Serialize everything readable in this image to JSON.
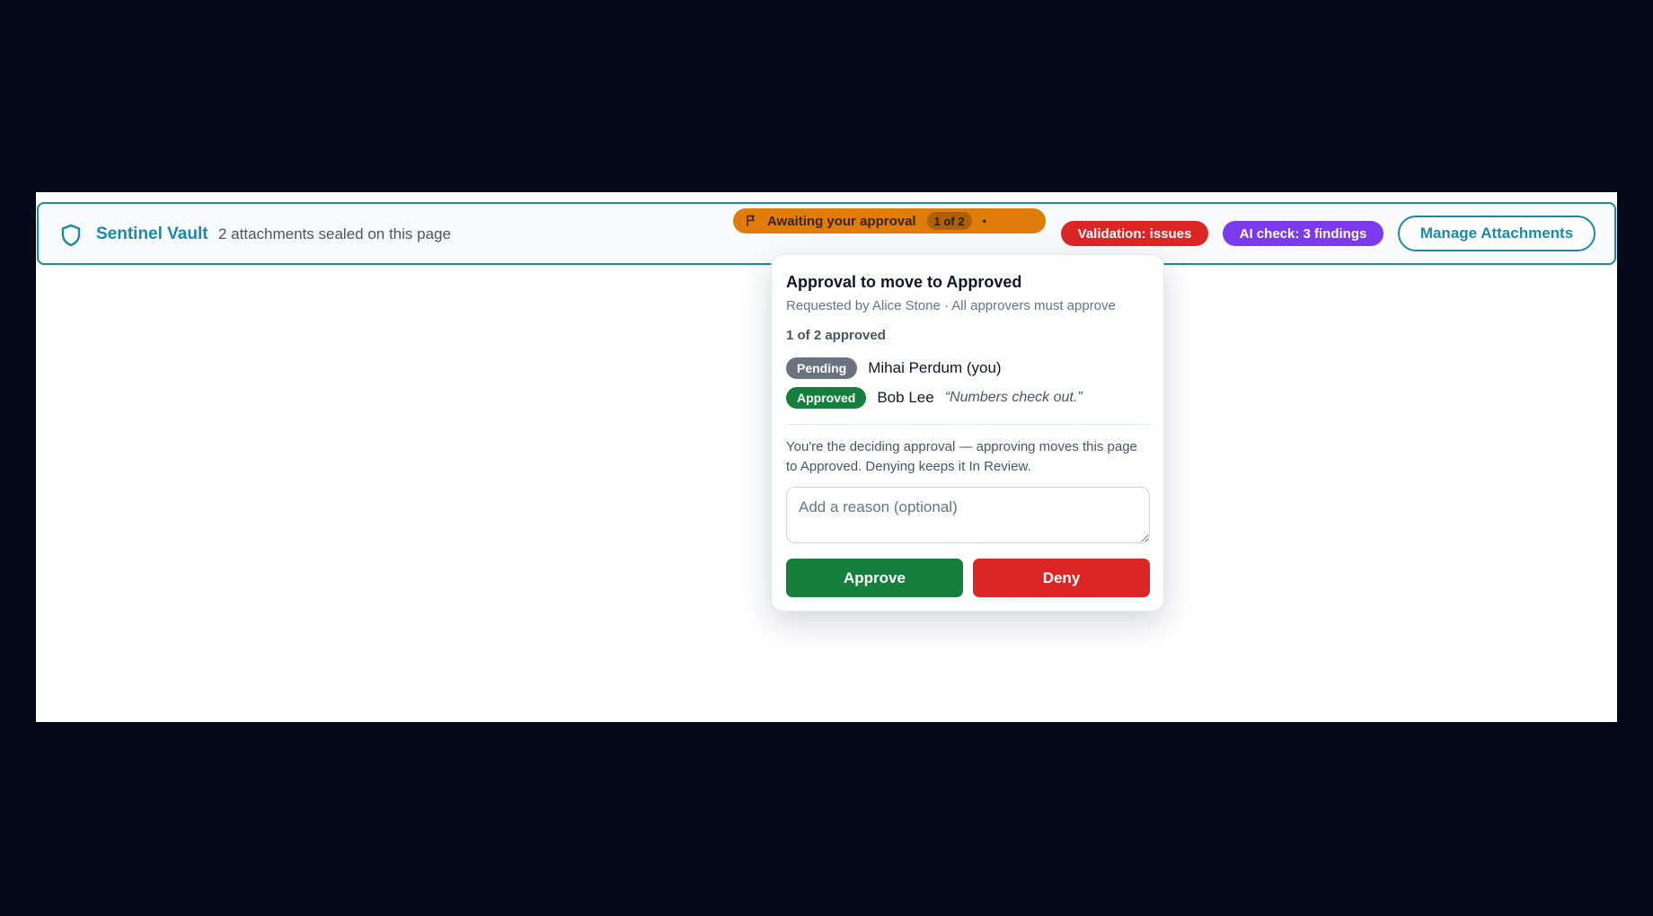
{
  "banner": {
    "brand": "Sentinel Vault",
    "status_text": "2 attachments sealed on this page",
    "approval_pill": {
      "label": "Awaiting your approval",
      "count": "1 of 2",
      "dot": "•"
    },
    "validation_pill": "Validation: issues",
    "ai_pill": "AI check: 3 findings",
    "manage_button": "Manage Attachments"
  },
  "popover": {
    "title": "Approval to move to Approved",
    "subtitle": "Requested by Alice Stone · All approvers must approve",
    "progress": "1 of 2 approved",
    "approvers": [
      {
        "status": "Pending",
        "name": "Mihai Perdum (you)",
        "comment": ""
      },
      {
        "status": "Approved",
        "name": "Bob Lee",
        "comment": "“Numbers check out.”"
      }
    ],
    "note": "You're the deciding approval — approving moves this page to Approved. Denying keeps it In Review.",
    "reason_placeholder": "Add a reason (optional)",
    "approve_label": "Approve",
    "deny_label": "Deny"
  },
  "colors": {
    "accent": "#1b8aa6",
    "awaiting": "#e07c0a",
    "validation": "#dc2626",
    "ai_check": "#7c3aed",
    "approved": "#15803d",
    "pending": "#6b7280"
  },
  "icons": {
    "brand": "shield-icon",
    "approval": "flag-icon"
  }
}
